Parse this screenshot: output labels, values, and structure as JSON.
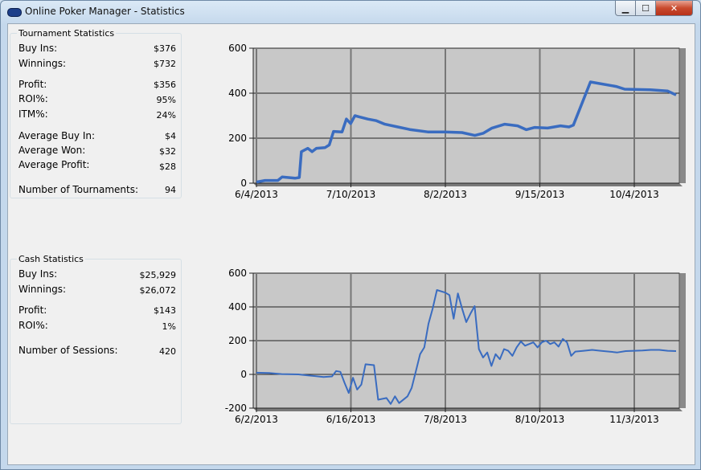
{
  "window": {
    "title": "Online Poker Manager - Statistics"
  },
  "controls": {
    "minimize": "▁",
    "maximize": "☐",
    "close": "✕"
  },
  "tournament": {
    "title": "Tournament Statistics",
    "rows": [
      {
        "label": "Buy Ins:",
        "value": "$376"
      },
      {
        "label": "Winnings:",
        "value": "$732"
      },
      {
        "label": "Profit:",
        "value": "$356"
      },
      {
        "label": "ROI%:",
        "value": "95%"
      },
      {
        "label": "ITM%:",
        "value": "24%"
      },
      {
        "label": "Average Buy In:",
        "value": "$4"
      },
      {
        "label": "Average Won:",
        "value": "$32"
      },
      {
        "label": "Average Profit:",
        "value": "$28"
      },
      {
        "label": "Number of Tournaments:",
        "value": "94"
      }
    ]
  },
  "cash": {
    "title": "Cash Statistics",
    "rows": [
      {
        "label": "Buy Ins:",
        "value": "$25,929"
      },
      {
        "label": "Winnings:",
        "value": "$26,072"
      },
      {
        "label": "Profit:",
        "value": "$143"
      },
      {
        "label": "ROI%:",
        "value": "1%"
      },
      {
        "label": "Number of Sessions:",
        "value": "420"
      }
    ]
  },
  "chart_data": [
    {
      "type": "line",
      "series_color": "#3a6cc0",
      "ylim": [
        0,
        600
      ],
      "yticks": [
        0,
        200,
        400,
        600
      ],
      "xticks": [
        "6/4/2013",
        "7/10/2013",
        "8/2/2013",
        "9/15/2013",
        "10/4/2013"
      ],
      "points": [
        [
          0,
          5
        ],
        [
          2,
          12
        ],
        [
          5,
          12
        ],
        [
          6,
          28
        ],
        [
          9,
          22
        ],
        [
          10,
          25
        ],
        [
          10.5,
          140
        ],
        [
          12,
          155
        ],
        [
          13,
          140
        ],
        [
          14,
          155
        ],
        [
          16,
          158
        ],
        [
          17,
          170
        ],
        [
          18,
          230
        ],
        [
          20,
          228
        ],
        [
          21,
          285
        ],
        [
          22,
          265
        ],
        [
          23,
          300
        ],
        [
          24,
          295
        ],
        [
          26,
          285
        ],
        [
          28,
          278
        ],
        [
          30,
          262
        ],
        [
          33,
          250
        ],
        [
          36,
          238
        ],
        [
          40,
          228
        ],
        [
          44,
          228
        ],
        [
          48,
          225
        ],
        [
          51,
          212
        ],
        [
          53,
          222
        ],
        [
          55,
          245
        ],
        [
          58,
          262
        ],
        [
          61,
          255
        ],
        [
          63,
          238
        ],
        [
          65,
          248
        ],
        [
          68,
          245
        ],
        [
          71,
          255
        ],
        [
          73,
          250
        ],
        [
          74,
          258
        ],
        [
          78,
          450
        ],
        [
          84,
          430
        ],
        [
          86,
          418
        ],
        [
          92,
          415
        ],
        [
          96,
          410
        ],
        [
          98,
          392
        ]
      ]
    },
    {
      "type": "line",
      "series_color": "#3a6cc0",
      "ylim": [
        -200,
        600
      ],
      "yticks": [
        -200,
        0,
        200,
        400,
        600
      ],
      "xticks": [
        "6/2/2013",
        "6/16/2013",
        "7/8/2013",
        "8/10/2013",
        "11/3/2013"
      ],
      "points": [
        [
          0,
          10
        ],
        [
          3,
          8
        ],
        [
          6,
          2
        ],
        [
          10,
          0
        ],
        [
          12,
          -5
        ],
        [
          14,
          -10
        ],
        [
          16,
          -15
        ],
        [
          18,
          -12
        ],
        [
          19,
          20
        ],
        [
          20,
          15
        ],
        [
          21,
          -50
        ],
        [
          22,
          -110
        ],
        [
          23,
          -20
        ],
        [
          24,
          -90
        ],
        [
          25,
          -60
        ],
        [
          26,
          60
        ],
        [
          28,
          55
        ],
        [
          29,
          -150
        ],
        [
          31,
          -140
        ],
        [
          32,
          -175
        ],
        [
          33,
          -130
        ],
        [
          34,
          -170
        ],
        [
          36,
          -130
        ],
        [
          37,
          -80
        ],
        [
          38,
          20
        ],
        [
          39,
          120
        ],
        [
          40,
          160
        ],
        [
          41,
          300
        ],
        [
          42,
          390
        ],
        [
          43,
          500
        ],
        [
          45,
          485
        ],
        [
          46,
          470
        ],
        [
          47,
          330
        ],
        [
          48,
          480
        ],
        [
          49,
          390
        ],
        [
          50,
          310
        ],
        [
          51,
          360
        ],
        [
          52,
          405
        ],
        [
          53,
          150
        ],
        [
          54,
          100
        ],
        [
          55,
          130
        ],
        [
          56,
          50
        ],
        [
          57,
          120
        ],
        [
          58,
          90
        ],
        [
          59,
          150
        ],
        [
          60,
          140
        ],
        [
          61,
          110
        ],
        [
          62,
          160
        ],
        [
          63,
          195
        ],
        [
          64,
          170
        ],
        [
          66,
          190
        ],
        [
          67,
          160
        ],
        [
          68,
          190
        ],
        [
          69,
          200
        ],
        [
          70,
          180
        ],
        [
          71,
          190
        ],
        [
          72,
          165
        ],
        [
          73,
          210
        ],
        [
          74,
          190
        ],
        [
          75,
          110
        ],
        [
          76,
          135
        ],
        [
          78,
          140
        ],
        [
          80,
          145
        ],
        [
          82,
          140
        ],
        [
          84,
          135
        ],
        [
          86,
          130
        ],
        [
          88,
          138
        ],
        [
          90,
          140
        ],
        [
          92,
          142
        ],
        [
          94,
          145
        ],
        [
          96,
          145
        ],
        [
          98,
          140
        ],
        [
          100,
          138
        ]
      ]
    }
  ]
}
